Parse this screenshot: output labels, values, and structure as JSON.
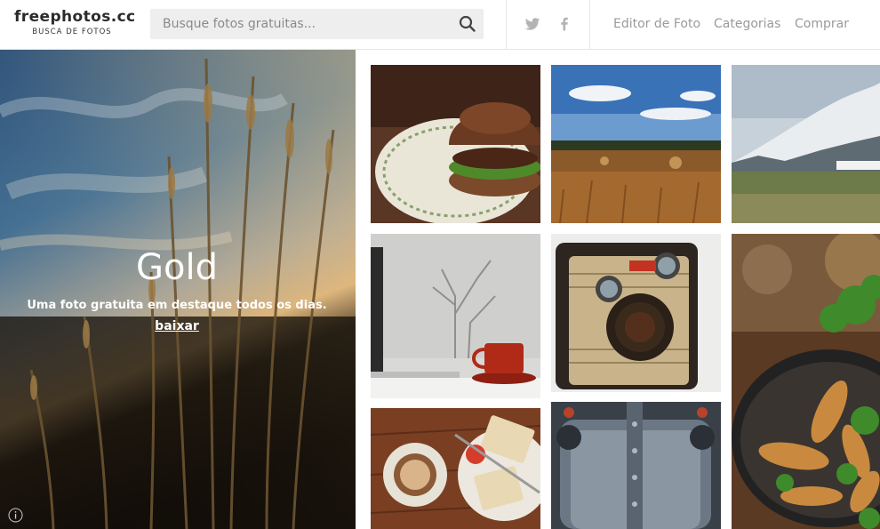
{
  "header": {
    "logo_title": "freephotos.cc",
    "logo_subtitle": "BUSCA DE FOTOS",
    "search": {
      "placeholder": "Busque fotos gratuitas...",
      "value": ""
    },
    "social": [
      {
        "icon": "twitter-icon"
      },
      {
        "icon": "facebook-icon"
      }
    ],
    "nav": {
      "editor": "Editor de Foto",
      "categorias": "Categorias",
      "comprar": "Comprar"
    }
  },
  "hero": {
    "title": "Gold",
    "subtitle": "Uma foto gratuita em destaque todos os dias.",
    "link": "baixar"
  },
  "colors": {
    "nav_text": "#9a9a9a",
    "logo_text": "#2b2b2b",
    "search_bg": "#eeeeee",
    "hero_text": "#ffffff"
  },
  "photos": [
    {
      "subject": "burger-on-plate"
    },
    {
      "subject": "field-with-hay-bales"
    },
    {
      "subject": "mountain-mist-landscape"
    },
    {
      "subject": "red-cup-foggy-window"
    },
    {
      "subject": "vintage-kodak-camera"
    },
    {
      "subject": "chicken-broccoli-pan"
    },
    {
      "subject": "coffee-and-toast-table"
    },
    {
      "subject": "metal-sink-faucets"
    }
  ]
}
